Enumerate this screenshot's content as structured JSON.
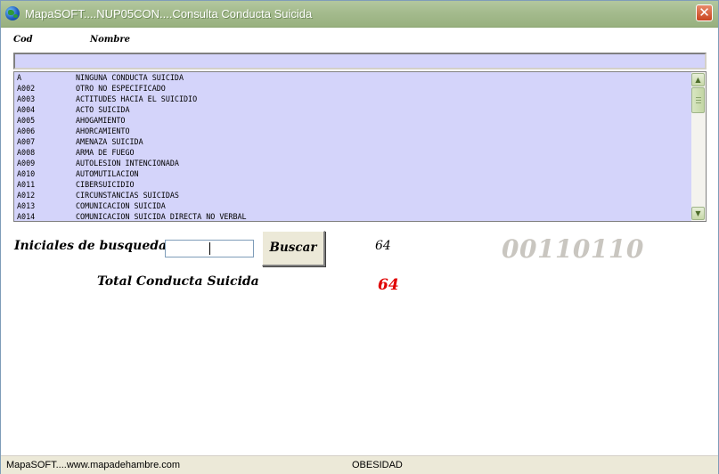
{
  "window": {
    "title": "MapaSOFT....NUP05CON....Consulta  Conducta Suicida",
    "close_glyph": "✕"
  },
  "table": {
    "headers": {
      "cod": "Cod",
      "nombre": "Nombre"
    },
    "rows": [
      {
        "cod": "A",
        "nombre": "NINGUNA CONDUCTA SUICIDA"
      },
      {
        "cod": "A002",
        "nombre": "OTRO NO ESPECIFICADO"
      },
      {
        "cod": "A003",
        "nombre": "ACTITUDES HACIA EL SUICIDIO"
      },
      {
        "cod": "A004",
        "nombre": "ACTO SUICIDA"
      },
      {
        "cod": "A005",
        "nombre": "AHOGAMIENTO"
      },
      {
        "cod": "A006",
        "nombre": "AHORCAMIENTO"
      },
      {
        "cod": "A007",
        "nombre": "AMENAZA SUICIDA"
      },
      {
        "cod": "A008",
        "nombre": "ARMA DE FUEGO"
      },
      {
        "cod": "A009",
        "nombre": "AUTOLESION INTENCIONADA"
      },
      {
        "cod": "A010",
        "nombre": "AUTOMUTILACION"
      },
      {
        "cod": "A011",
        "nombre": "CIBERSUICIDIO"
      },
      {
        "cod": "A012",
        "nombre": "CIRCUNSTANCIAS SUICIDAS"
      },
      {
        "cod": "A013",
        "nombre": "COMUNICACION SUICIDA"
      },
      {
        "cod": "A014",
        "nombre": "COMUNICACION SUICIDA DIRECTA NO VERBAL"
      }
    ]
  },
  "scrollbar": {
    "up_glyph": "▲",
    "down_glyph": "▼"
  },
  "search": {
    "label": "Iniciales de busqueda",
    "value": "",
    "button_label": "Buscar",
    "result_count": "64",
    "code": "00110110"
  },
  "total": {
    "label": "Total  Conducta Suicida",
    "value": "64"
  },
  "statusbar": {
    "left": "MapaSOFT....www.mapadehambre.com",
    "middle": "OBESIDAD"
  },
  "colors": {
    "list_background": "#d4d4fa",
    "titlebar": "#a4bb8d",
    "total_value": "#e00000",
    "code_gray": "#c9c6c0"
  }
}
